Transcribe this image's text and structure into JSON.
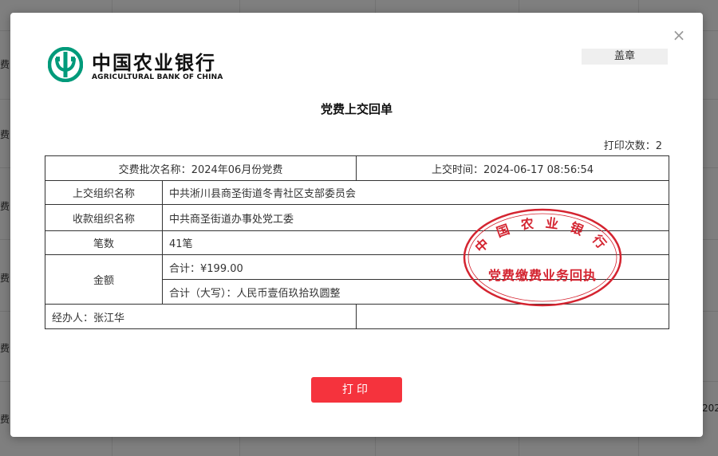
{
  "background": {
    "left_cells": [
      "党费",
      "党费",
      "党费",
      "党费",
      "党费",
      "党费"
    ],
    "right_cell": "202"
  },
  "dialog": {
    "close_symbol": "×",
    "logo": {
      "name_cn": "中国农业银行",
      "name_en": "AGRICULTURAL BANK OF CHINA"
    },
    "seal_button": "盖章",
    "title": "党费上交回单",
    "print_count_label": "打印次数：",
    "print_count_value": "2",
    "table": {
      "batch_label": "交费批次名称：",
      "batch_value": "2024年06月份党费",
      "time_label": "上交时间：",
      "time_value": "2024-06-17 08:56:54",
      "submit_org_label": "上交组织名称",
      "submit_org_value": "中共淅川县商圣街道冬青社区支部委员会",
      "receive_org_label": "收款组织名称",
      "receive_org_value": "中共商圣街道办事处党工委",
      "count_label": "笔数",
      "count_value": "41笔",
      "amount_label": "金额",
      "total_label": "合计：",
      "total_value": "¥199.00",
      "total_upper_label": "合计（大写）：",
      "total_upper_value": "人民币壹佰玖拾玖圆整",
      "handler_label": "经办人：",
      "handler_value": "张江华"
    },
    "stamp": {
      "arc_text": "中国农业银行",
      "center_text": "党费缴费业务回执"
    },
    "print_button": "打印"
  },
  "colors": {
    "accent_red": "#f5333d",
    "stamp_red": "#d42430",
    "logo_green": "#009a7a"
  }
}
